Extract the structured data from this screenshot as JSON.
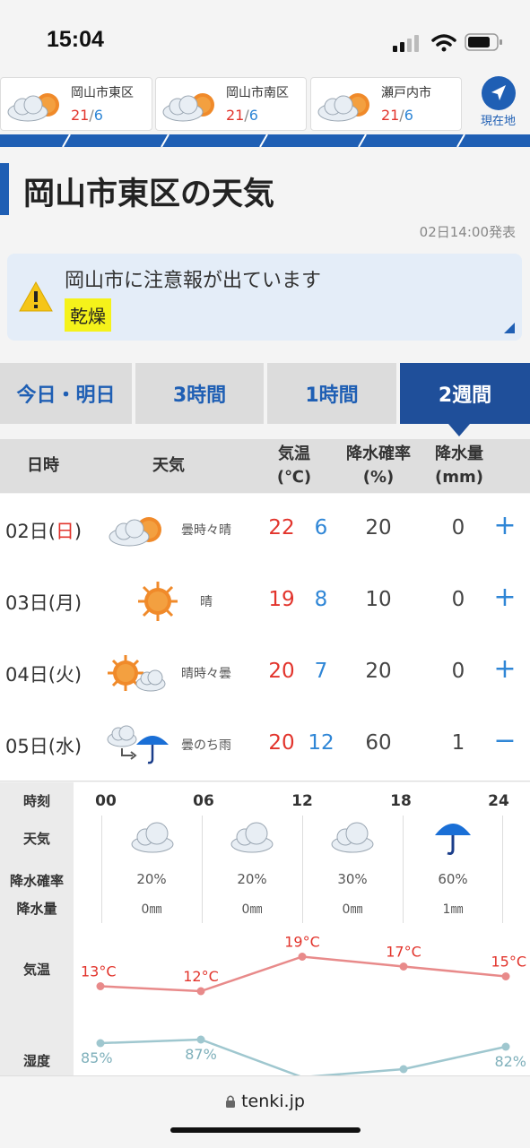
{
  "status": {
    "time": "15:04"
  },
  "locations": [
    {
      "name": "岡山市東区",
      "hi": "21",
      "lo": "6"
    },
    {
      "name": "岡山市南区",
      "hi": "21",
      "lo": "6"
    },
    {
      "name": "瀬戸内市",
      "hi": "21",
      "lo": "6"
    }
  ],
  "current_location_label": "現在地",
  "page_title": "岡山市東区の天気",
  "issued": "02日14:00発表",
  "warning": {
    "message": "岡山市に注意報が出ています",
    "tag": "乾燥"
  },
  "tabs": [
    {
      "label": "今日・明日"
    },
    {
      "label": "3時間"
    },
    {
      "label": "1時間"
    },
    {
      "label": "2週間"
    }
  ],
  "table_header": {
    "date": "日時",
    "weather": "天気",
    "temp1": "気温",
    "temp2": "(℃)",
    "pop1": "降水確率",
    "pop2": "(%)",
    "amt1": "降水量",
    "amt2": "(mm)"
  },
  "days": [
    {
      "date_pre": "02日(",
      "dow": "日",
      "date_post": ")",
      "weather": "曇時々晴",
      "icon": "cloud-sun-icon",
      "hi": "22",
      "lo": "6",
      "pop": "20",
      "amt": "0",
      "toggle": "+"
    },
    {
      "date_pre": "03日(",
      "dow": "月",
      "date_post": ")",
      "weather": "晴",
      "icon": "sun-icon",
      "hi": "19",
      "lo": "8",
      "pop": "10",
      "amt": "0",
      "toggle": "+"
    },
    {
      "date_pre": "04日(",
      "dow": "火",
      "date_post": ")",
      "weather": "晴時々曇",
      "icon": "sun-cloud-icon",
      "hi": "20",
      "lo": "7",
      "pop": "20",
      "amt": "0",
      "toggle": "+"
    },
    {
      "date_pre": "05日(",
      "dow": "水",
      "date_post": ")",
      "weather": "曇のち雨",
      "icon": "cloud-then-rain-icon",
      "hi": "20",
      "lo": "12",
      "pop": "60",
      "amt": "1",
      "toggle": "−"
    }
  ],
  "hourly": {
    "labels": {
      "time": "時刻",
      "weather": "天気",
      "pop": "降水確率",
      "amt": "降水量",
      "temp": "気温",
      "humidity": "湿度"
    },
    "hours": [
      "00",
      "06",
      "12",
      "18",
      "24"
    ],
    "slots": [
      {
        "icon": "cloud-icon",
        "pop": "20%",
        "amt": "0㎜"
      },
      {
        "icon": "cloud-icon",
        "pop": "20%",
        "amt": "0㎜"
      },
      {
        "icon": "cloud-icon",
        "pop": "30%",
        "amt": "0㎜"
      },
      {
        "icon": "umbrella-icon",
        "pop": "60%",
        "amt": "1㎜"
      }
    ]
  },
  "chart_data": {
    "type": "line",
    "x": [
      "00",
      "06",
      "12",
      "18",
      "24"
    ],
    "series": [
      {
        "values": [
          13,
          12,
          19,
          17,
          15
        ],
        "labels": [
          "13°C",
          "12°C",
          "19°C",
          "17°C",
          "15°C"
        ]
      },
      {
        "values": [
          85,
          87,
          null,
          null,
          82
        ],
        "labels": [
          "85%",
          "87%",
          "",
          "",
          "82%"
        ]
      }
    ],
    "colors": {
      "temperature": "#e88a8a",
      "humidity": "#9fc7cf"
    }
  },
  "url": "tenki.jp"
}
